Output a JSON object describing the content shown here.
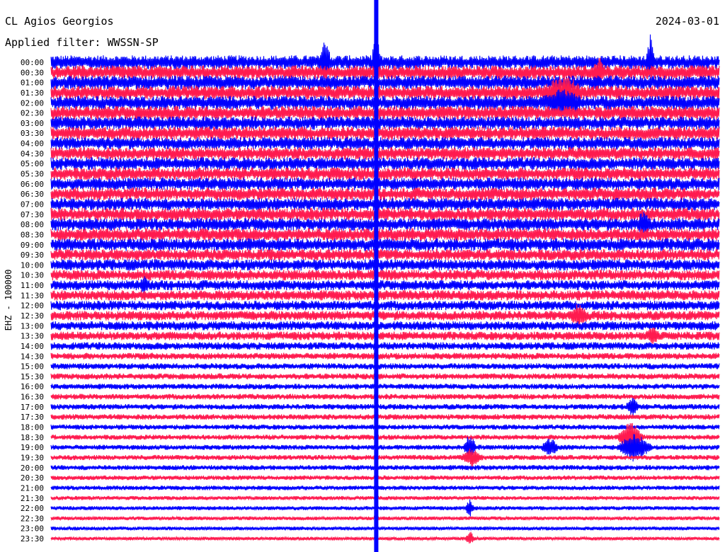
{
  "header": {
    "station": "CL Agios Georgios",
    "filter_label": "Applied filter: WWSSN-SP",
    "date": "2024-03-01"
  },
  "chart_data": {
    "type": "line",
    "ylabel": "EHZ - 100000",
    "xlim": [
      0,
      30
    ],
    "hour_labels": [
      "00:00",
      "00:30",
      "01:00",
      "01:30",
      "02:00",
      "02:30",
      "03:00",
      "03:30",
      "04:00",
      "04:30",
      "05:00",
      "05:30",
      "06:00",
      "06:30",
      "07:00",
      "07:30",
      "08:00",
      "08:30",
      "09:00",
      "09:30",
      "10:00",
      "10:30",
      "11:00",
      "11:30",
      "12:00",
      "12:30",
      "13:00",
      "13:30",
      "14:00",
      "14:30",
      "15:00",
      "15:30",
      "16:00",
      "16:30",
      "17:00",
      "17:30",
      "18:00",
      "18:30",
      "19:00",
      "19:30",
      "20:00",
      "20:30",
      "21:00",
      "21:30",
      "22:00",
      "22:30",
      "23:00",
      "23:30"
    ],
    "colors": [
      "#0000ff",
      "#ff1a4f"
    ],
    "noise_level": [
      0.55,
      0.55,
      0.55,
      0.55,
      0.55,
      0.55,
      0.52,
      0.52,
      0.5,
      0.5,
      0.5,
      0.5,
      0.5,
      0.5,
      0.5,
      0.5,
      0.5,
      0.5,
      0.5,
      0.45,
      0.45,
      0.42,
      0.4,
      0.4,
      0.38,
      0.38,
      0.36,
      0.34,
      0.3,
      0.26,
      0.24,
      0.24,
      0.22,
      0.22,
      0.22,
      0.22,
      0.2,
      0.2,
      0.2,
      0.2,
      0.2,
      0.18,
      0.18,
      0.16,
      0.16,
      0.15,
      0.15,
      0.14
    ],
    "events": [
      {
        "row": 0,
        "x": 12.3,
        "amp": 3.2,
        "width": 0.25
      },
      {
        "row": 0,
        "x": 14.6,
        "amp": 4.0,
        "width": 0.2
      },
      {
        "row": 0,
        "x": 26.9,
        "amp": 3.0,
        "width": 0.2
      },
      {
        "row": 1,
        "x": 24.6,
        "amp": 1.6,
        "width": 0.3
      },
      {
        "row": 3,
        "x": 23.0,
        "amp": 2.0,
        "width": 0.9
      },
      {
        "row": 4,
        "x": 23.0,
        "amp": 1.4,
        "width": 0.9
      },
      {
        "row": 16,
        "x": 26.6,
        "amp": 1.4,
        "width": 0.3
      },
      {
        "row": 22,
        "x": 4.2,
        "amp": 1.0,
        "width": 0.2
      },
      {
        "row": 25,
        "x": 23.7,
        "amp": 1.2,
        "width": 0.4
      },
      {
        "row": 27,
        "x": 27.0,
        "amp": 1.0,
        "width": 0.3
      },
      {
        "row": 34,
        "x": 26.1,
        "amp": 1.2,
        "width": 0.3
      },
      {
        "row": 37,
        "x": 26.0,
        "amp": 2.4,
        "width": 0.6
      },
      {
        "row": 38,
        "x": 26.2,
        "amp": 2.0,
        "width": 0.8
      },
      {
        "row": 38,
        "x": 18.8,
        "amp": 1.8,
        "width": 0.3
      },
      {
        "row": 39,
        "x": 18.9,
        "amp": 1.2,
        "width": 0.5
      },
      {
        "row": 38,
        "x": 22.4,
        "amp": 1.2,
        "width": 0.4
      },
      {
        "row": 44,
        "x": 18.8,
        "amp": 1.2,
        "width": 0.2
      },
      {
        "row": 47,
        "x": 18.8,
        "amp": 1.0,
        "width": 0.2
      }
    ],
    "spikes": [
      {
        "x": 14.6,
        "from_row": 0,
        "to_row": 47
      }
    ]
  }
}
